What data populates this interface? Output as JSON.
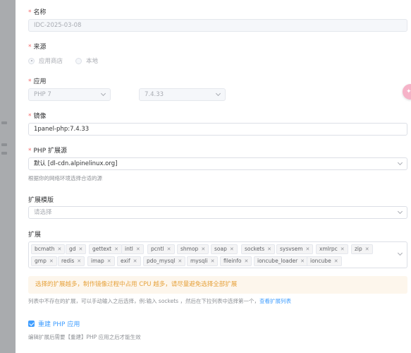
{
  "form": {
    "name": {
      "label": "名称",
      "value": "IDC-2025-03-08"
    },
    "source": {
      "label": "来源",
      "options": [
        "应用商店",
        "本地"
      ],
      "selected": "应用商店"
    },
    "app": {
      "label": "应用",
      "app_value": "PHP 7",
      "version_value": "7.4.33"
    },
    "image": {
      "label": "镜像",
      "value": "1panel-php:7.4.33"
    },
    "ext_source": {
      "label": "PHP 扩展源",
      "value": "默认 [dl-cdn.alpinelinux.org]",
      "hint": "根据你的网络环境选择合适的源"
    },
    "ext_template": {
      "label": "扩展模版",
      "placeholder": "请选择"
    },
    "extensions": {
      "label": "扩展",
      "row1": [
        "bcmath",
        "gd",
        "gettext",
        "intl",
        "pcntl",
        "shmop",
        "soap",
        "sockets",
        "sysvsem",
        "xmlrpc",
        "zip"
      ],
      "row2": [
        "gmp",
        "redis",
        "imap",
        "exif",
        "pdo_mysql",
        "mysqli",
        "fileinfo",
        "ioncube_loader",
        "ioncube"
      ]
    },
    "warning": "选择的扩展越多，制作镜像过程中占用 CPU 越多，请尽量避免选择全部扩展",
    "ext_hint": "列表中不存在的扩展，可以手动输入之后选择，例:输入 sockets ，然后在下拉列表中选择第一个，",
    "ext_link": "查看扩展列表",
    "rebuild": {
      "label": "重建 PHP 应用",
      "checked": true,
      "hint": "编辑扩展后需要【重建】PHP 应用之后才能生效"
    }
  }
}
